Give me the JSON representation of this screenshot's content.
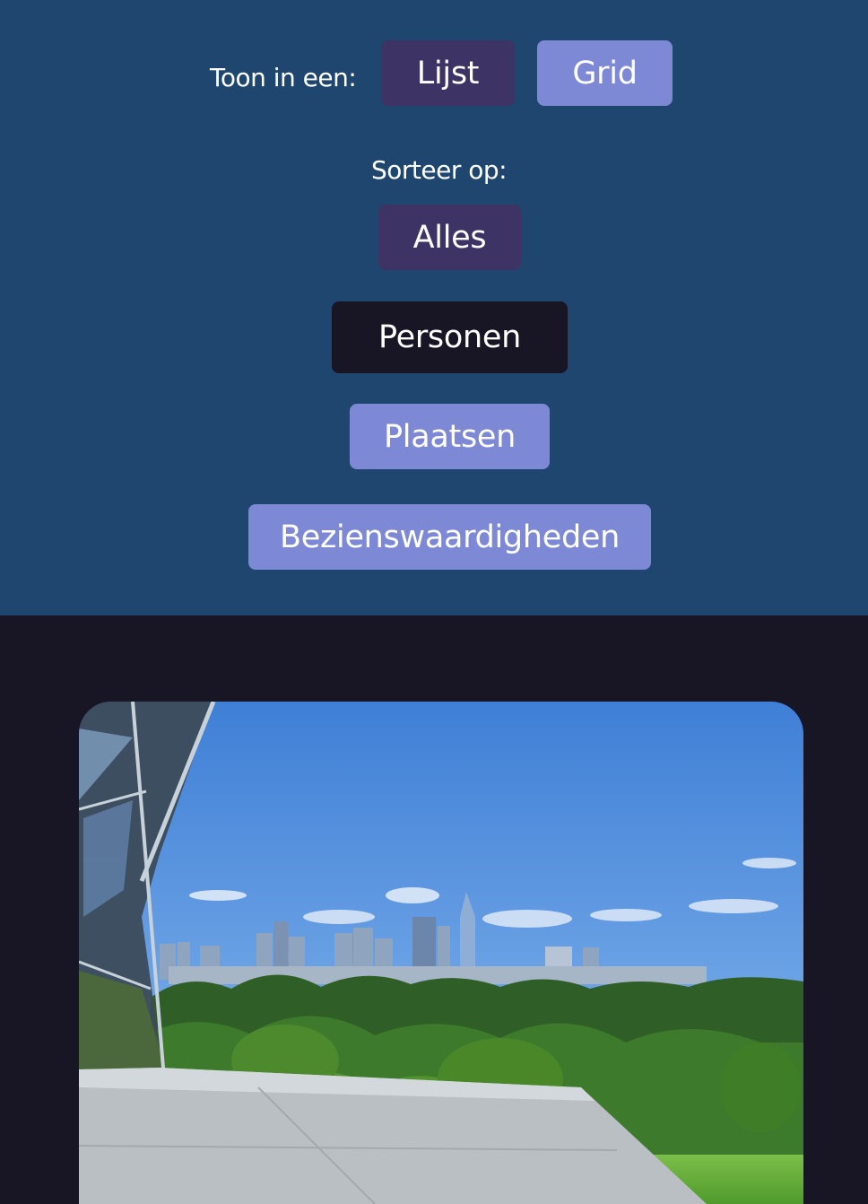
{
  "view_toggle": {
    "label": "Toon in een:",
    "options": [
      "Lijst",
      "Grid"
    ]
  },
  "sort": {
    "label": "Sorteer op:",
    "options": [
      "Alles",
      "Personen",
      "Plaatsen",
      "Bezienswaardigheden"
    ]
  },
  "colors": {
    "header_bg": "#1f466f",
    "page_bg": "#181525",
    "button_dark": "#3d3365",
    "button_light": "#7e89d6",
    "button_active": "#181525"
  },
  "photo": {
    "subject": "city skyline behind a green park seen from a glass building terrace"
  }
}
